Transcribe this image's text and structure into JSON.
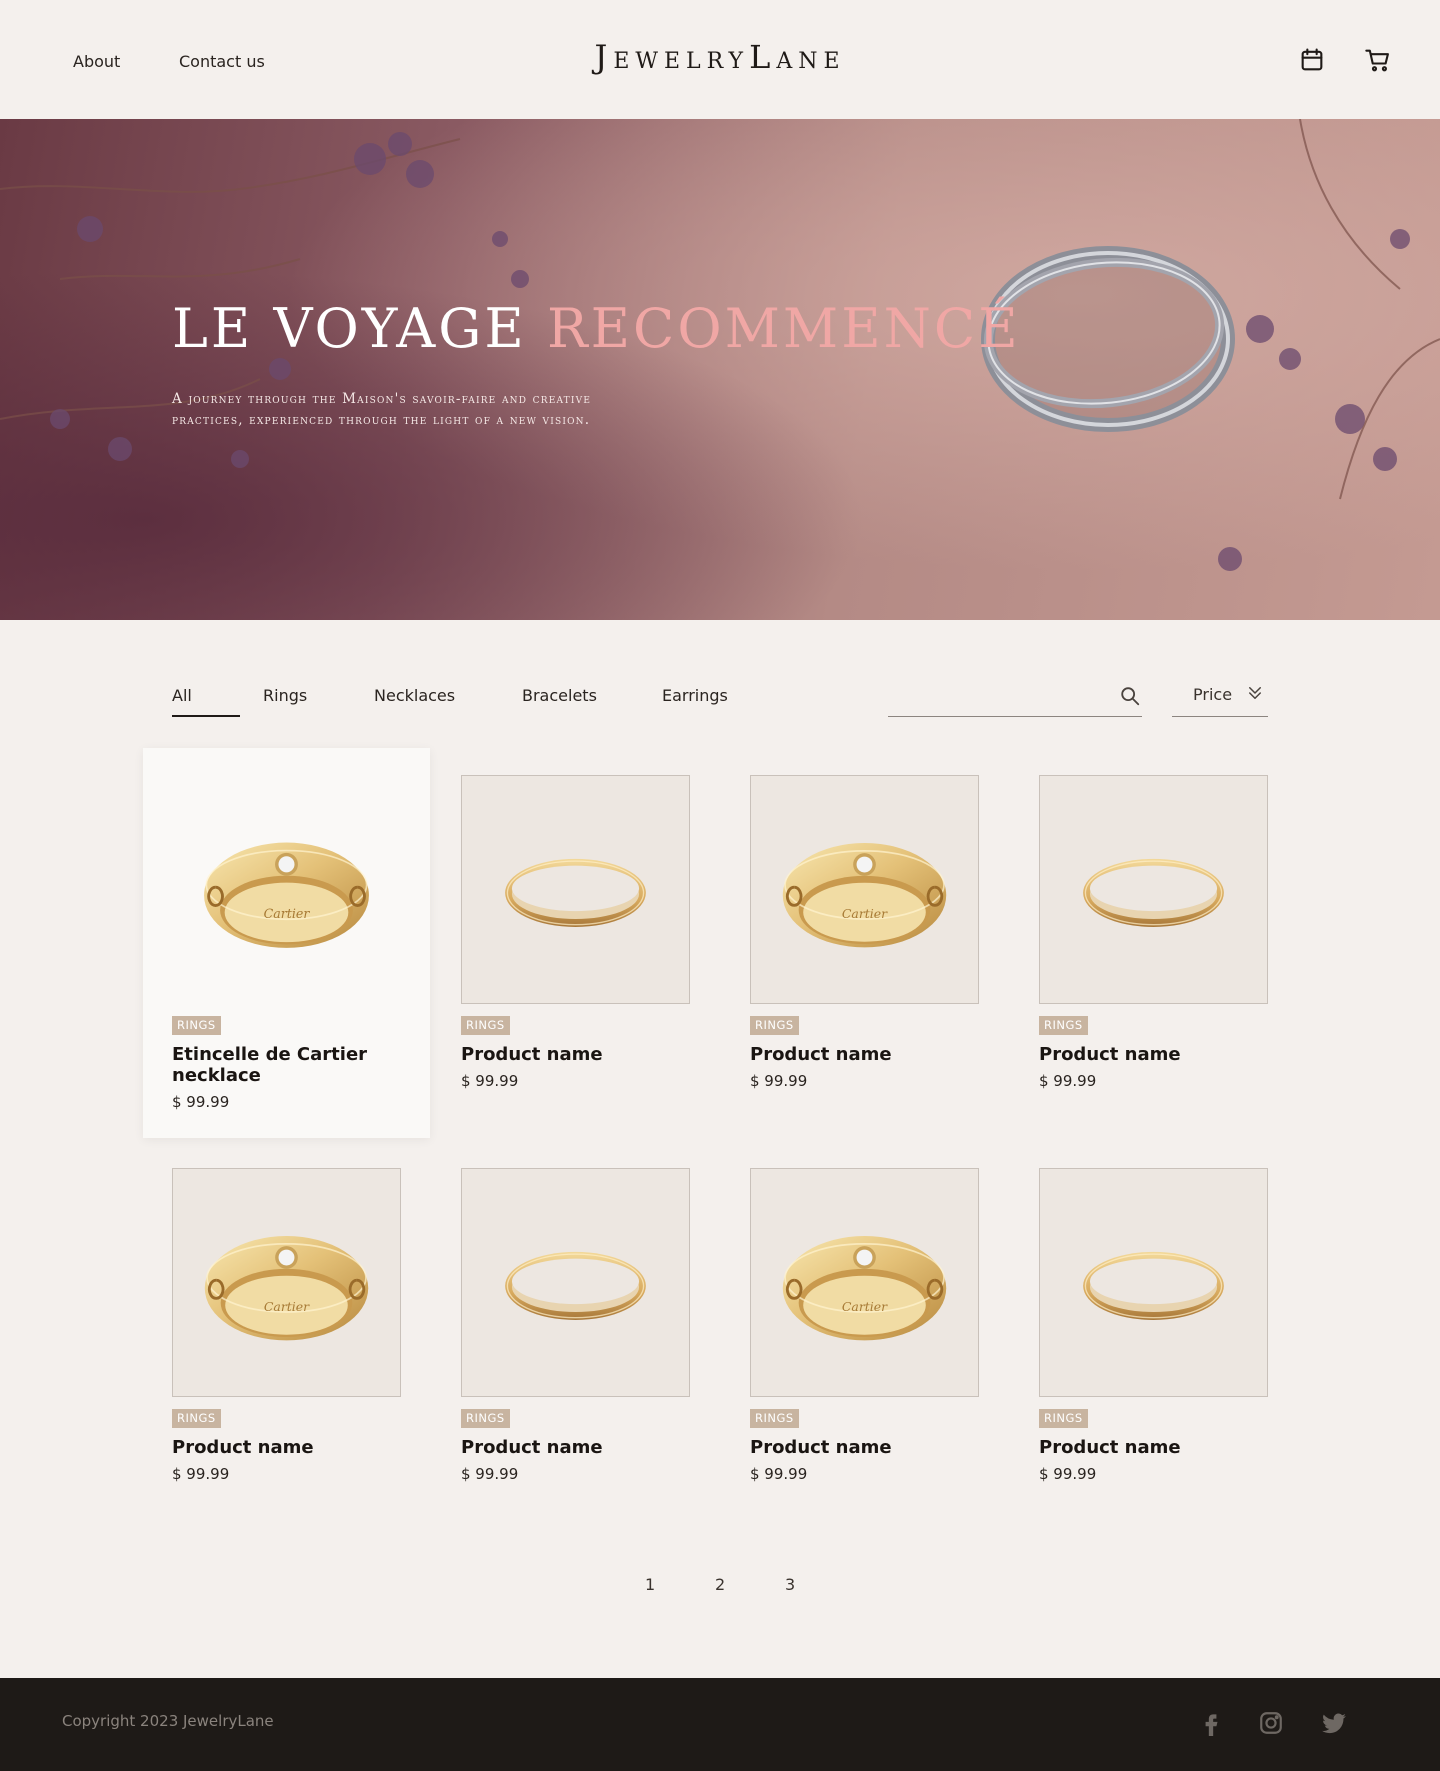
{
  "header": {
    "nav": [
      "About",
      "Contact us"
    ],
    "logo": "JewelryLane",
    "icons": [
      "calendar-icon",
      "cart-icon"
    ]
  },
  "hero": {
    "title_main": "LE VOYAGE",
    "title_accent": "RECOMMENCÉ",
    "subtitle": "A journey through the Maison's savoir-faire and creative practices, experienced through the light of a new vision."
  },
  "filters": {
    "tabs": [
      "All",
      "Rings",
      "Necklaces",
      "Bracelets",
      "Earrings"
    ],
    "active_tab": "All",
    "search_placeholder": "",
    "sort_label": "Price"
  },
  "products": [
    {
      "category": "RINGS",
      "name": "Etincelle de Cartier necklace",
      "price": "$ 99.99",
      "image": "cartier-love-ring-diamond",
      "featured": true
    },
    {
      "category": "RINGS",
      "name": "Product name",
      "price": "$ 99.99",
      "image": "gold-band-ring"
    },
    {
      "category": "RINGS",
      "name": "Product name",
      "price": "$ 99.99",
      "image": "cartier-love-ring-diamond"
    },
    {
      "category": "RINGS",
      "name": "Product name",
      "price": "$ 99.99",
      "image": "gold-band-ring"
    },
    {
      "category": "RINGS",
      "name": "Product name",
      "price": "$ 99.99",
      "image": "cartier-love-ring-diamond"
    },
    {
      "category": "RINGS",
      "name": "Product name",
      "price": "$ 99.99",
      "image": "gold-band-ring"
    },
    {
      "category": "RINGS",
      "name": "Product name",
      "price": "$ 99.99",
      "image": "cartier-love-ring-diamond"
    },
    {
      "category": "RINGS",
      "name": "Product name",
      "price": "$ 99.99",
      "image": "gold-band-ring"
    }
  ],
  "pagination": [
    "1",
    "2",
    "3"
  ],
  "footer": {
    "copyright": "Copyright 2023 JewelryLane",
    "social": [
      "facebook-icon",
      "instagram-icon",
      "twitter-icon"
    ]
  },
  "colors": {
    "background": "#f4f0ed",
    "hero_accent": "#f0a7a5",
    "badge": "#c8b4a0",
    "footer": "#1e1a17"
  }
}
